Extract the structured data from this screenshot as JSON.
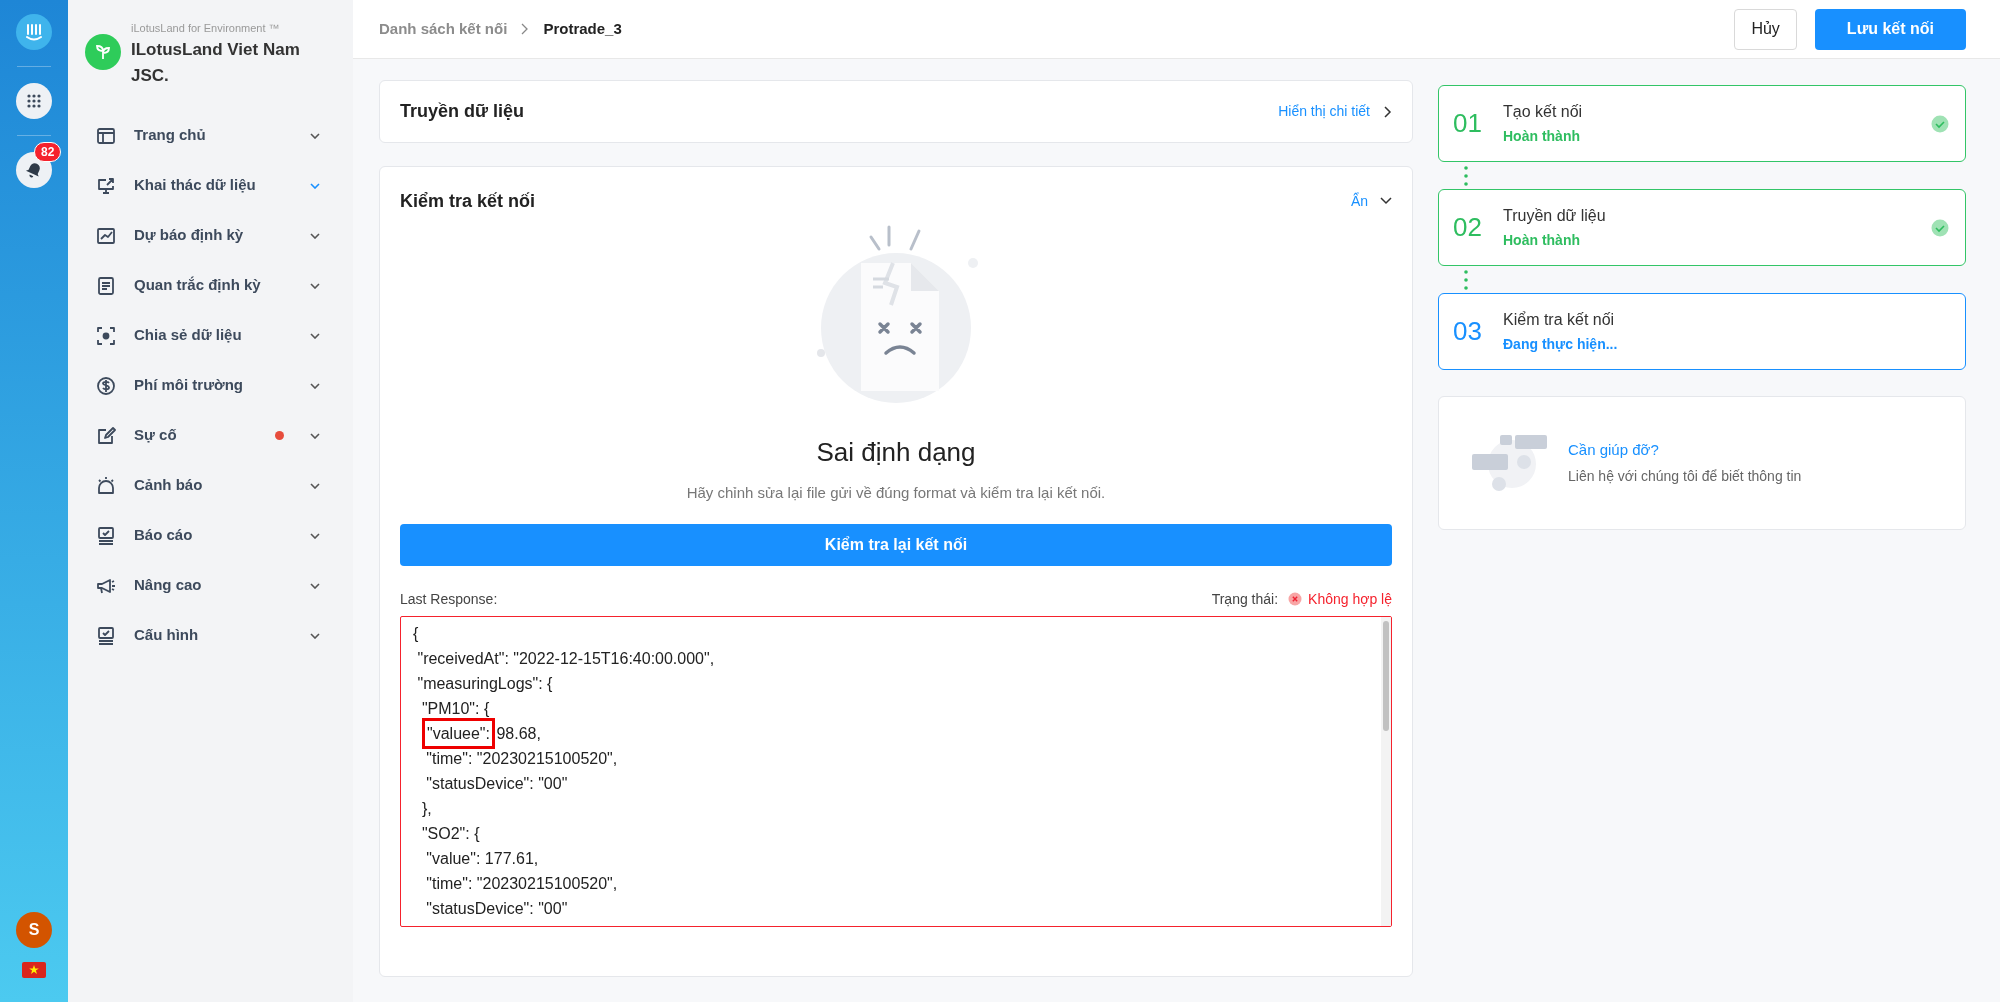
{
  "rail": {
    "badge": "82",
    "avatar": "S"
  },
  "brand": {
    "tagline": "iLotusLand for Environment ™",
    "name": "ILotusLand Viet Nam JSC."
  },
  "sidebar": {
    "items": [
      {
        "label": "Trang chủ",
        "selected": false,
        "alert": false
      },
      {
        "label": "Khai thác dữ liệu",
        "selected": true,
        "alert": false
      },
      {
        "label": "Dự báo định kỳ",
        "selected": false,
        "alert": false
      },
      {
        "label": "Quan trắc định kỳ",
        "selected": false,
        "alert": false
      },
      {
        "label": "Chia sẻ dữ liệu",
        "selected": false,
        "alert": false
      },
      {
        "label": "Phí môi trường",
        "selected": false,
        "alert": false
      },
      {
        "label": "Sự cố",
        "selected": false,
        "alert": true
      },
      {
        "label": "Cảnh báo",
        "selected": false,
        "alert": false
      },
      {
        "label": "Báo cáo",
        "selected": false,
        "alert": false
      },
      {
        "label": "Nâng cao",
        "selected": false,
        "alert": false
      },
      {
        "label": "Cấu hình",
        "selected": false,
        "alert": false
      }
    ]
  },
  "breadcrumb": [
    "Danh sách kết nối",
    "Protrade_3"
  ],
  "header_buttons": [
    {
      "label": "Hủy",
      "kind": "default"
    },
    {
      "label": "Lưu kết nối",
      "kind": "primary"
    }
  ],
  "transfer_card": {
    "title": "Truyền dữ liệu",
    "link": "Hiển thị chi tiết"
  },
  "check_card": {
    "title": "Kiểm tra kết nối",
    "toggle": "Ẩn",
    "expanded": true,
    "result_title": "Sai định dạng",
    "result_text": "Hãy chỉnh sửa lại file gửi về đúng format và kiểm tra lại kết nối.",
    "retry_button": "Kiểm tra lại kết nối",
    "response_label": "Last Response:",
    "status_label": "Trạng thái:",
    "status_value": "Không hợp lệ",
    "code_lines": [
      {
        "text": "{"
      },
      {
        "text": " \"receivedAt\": \"2022-12-15T16:40:00.000\","
      },
      {
        "text": " \"measuringLogs\": {"
      },
      {
        "text": "  \"PM10\": {"
      },
      {
        "highlight": "\"valuee\":",
        "rest": " 98.68,"
      },
      {
        "text": "   \"time\": \"20230215100520\","
      },
      {
        "text": "   \"statusDevice\": \"00\""
      },
      {
        "text": "  },"
      },
      {
        "text": "  \"SO2\": {"
      },
      {
        "text": "   \"value\": 177.61,"
      },
      {
        "text": "   \"time\": \"20230215100520\","
      },
      {
        "text": "   \"statusDevice\": \"00\""
      }
    ]
  },
  "steps": [
    {
      "number": "01",
      "title": "Tạo kết nối",
      "status": "Hoàn thành",
      "done": true
    },
    {
      "number": "02",
      "title": "Truyền dữ liệu",
      "status": "Hoàn thành",
      "done": true
    },
    {
      "number": "03",
      "title": "Kiểm tra kết nối",
      "status": "Đang thực hiện...",
      "done": false
    }
  ],
  "help": {
    "title": "Cần giúp đỡ?",
    "text": "Liên hệ với chúng tôi để biết thông tin"
  }
}
